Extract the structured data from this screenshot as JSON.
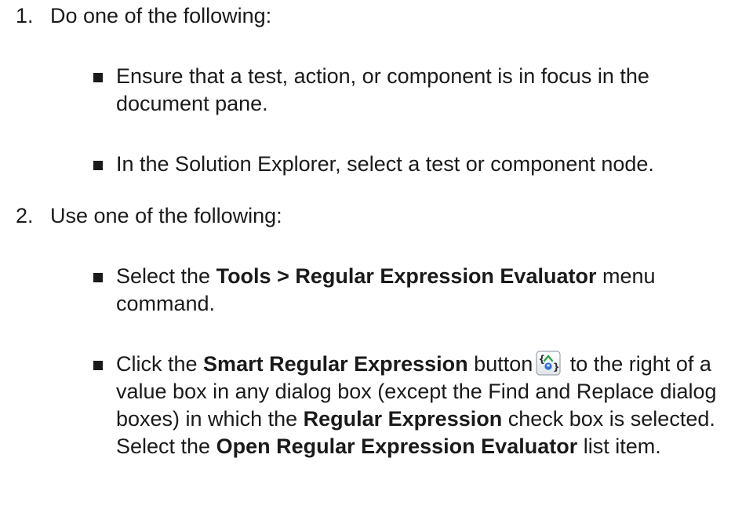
{
  "step1": {
    "number": "1.",
    "text": "Do one of the following:",
    "bullets": [
      "Ensure that a test, action, or component is in focus in the document pane.",
      "In the Solution Explorer, select a test or component node."
    ]
  },
  "step2": {
    "number": "2.",
    "text": "Use one of the following:",
    "bullet1": {
      "pre": "Select the ",
      "bold": "Tools > Regular Expression Evaluator",
      "post": " menu command."
    },
    "bullet2": {
      "t1": "Click the ",
      "b1": "Smart Regular Expression",
      "t2": " button",
      "icon": "smart-regex-button-icon",
      "t3": " to the right of a value box in any dialog box (except the Find and Replace dialog boxes) in which the ",
      "b2": "Regular Expression",
      "t4": " check box is selected. Select the ",
      "b3": "Open Regular Expression Evaluator",
      "t5": " list item."
    }
  }
}
